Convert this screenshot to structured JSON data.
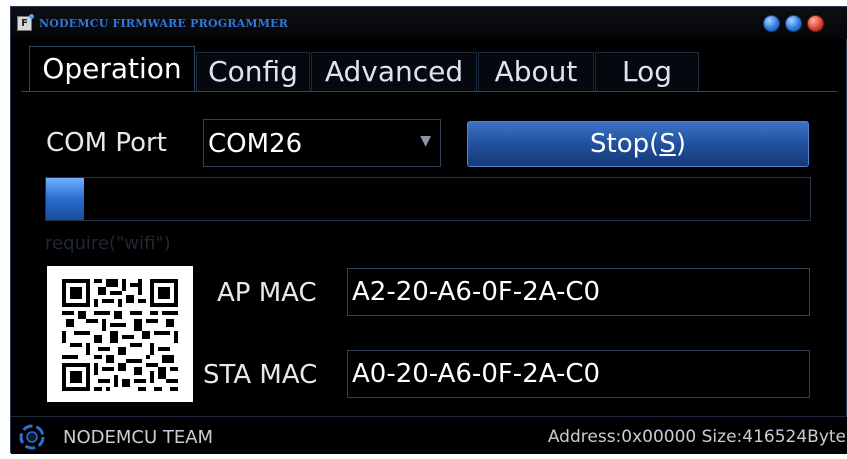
{
  "window": {
    "title": "NODEMCU FIRMWARE PROGRAMMER",
    "icon_letter": "F",
    "controls": [
      "minimize-icon",
      "maximize-icon",
      "close-icon"
    ],
    "accent": "#2e7de6",
    "close_color": "#e04534"
  },
  "tabs": [
    {
      "label": "Operation",
      "active": true
    },
    {
      "label": "Config",
      "active": false
    },
    {
      "label": "Advanced",
      "active": false
    },
    {
      "label": "About",
      "active": false
    },
    {
      "label": "Log",
      "active": false
    }
  ],
  "operation": {
    "com_port_label": "COM Port",
    "com_port_value": "COM26",
    "stop_button": {
      "prefix": "Stop(",
      "hotkey": "S",
      "suffix": ")"
    },
    "progress": 0.05,
    "console_text": "require(\"wifi\")",
    "qr_icon": "qr-code-icon",
    "ap_mac_label": "AP MAC",
    "ap_mac_value": "A2-20-A6-0F-2A-C0",
    "sta_mac_label": "STA MAC",
    "sta_mac_value": "A0-20-A6-0F-2A-C0"
  },
  "status": {
    "team": "NODEMCU TEAM",
    "address_size": "Address:0x00000  Size:416524Byte"
  }
}
